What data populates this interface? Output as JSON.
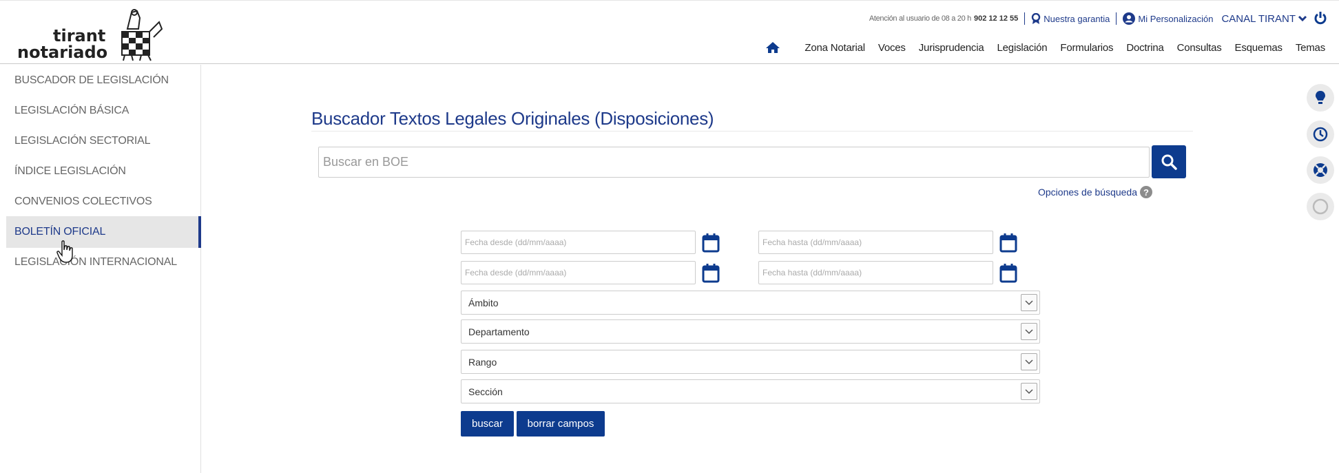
{
  "header": {
    "logo": {
      "line1": "tirant",
      "line2": "notariado"
    },
    "utility": {
      "hours": "Atención al usuario de 08 a 20 h",
      "phone": "902 12 12 55",
      "guarantee": "Nuestra garantia",
      "personalization": "Mi Personalización",
      "canal": "CANAL TIRANT"
    },
    "nav": [
      "Zona Notarial",
      "Voces",
      "Jurisprudencia",
      "Legislación",
      "Formularios",
      "Doctrina",
      "Consultas",
      "Esquemas",
      "Temas"
    ]
  },
  "sidebar": {
    "items": [
      {
        "label": "Buscador de legislación"
      },
      {
        "label": "Legislación básica"
      },
      {
        "label": "Legislación sectorial"
      },
      {
        "label": "Índice legislación"
      },
      {
        "label": "Convenios colectivos"
      },
      {
        "label": "Boletín oficial",
        "active": true
      },
      {
        "label": "Legislación internacional"
      }
    ]
  },
  "main": {
    "title": "Buscador Textos Legales Originales (Disposiciones)",
    "search_placeholder": "Buscar en BOE",
    "search_options": "Opciones de búsqueda",
    "help_glyph": "?",
    "dates": {
      "from_placeholder": "Fecha desde (dd/mm/aaaa)",
      "to_placeholder": "Fecha hasta (dd/mm/aaaa)"
    },
    "selects": [
      "Ámbito",
      "Departamento",
      "Rango",
      "Sección"
    ],
    "buttons": {
      "search": "buscar",
      "clear": "borrar campos"
    }
  },
  "colors": {
    "brand": "#0d3b8e",
    "link": "#1e3a8a",
    "sidebar_active_bg": "#e6e6e6"
  },
  "icons": [
    "home-icon",
    "search-icon",
    "calendar-icon",
    "chevron-down-icon",
    "lightbulb-icon",
    "clock-icon",
    "lifebuoy-icon",
    "circle-icon",
    "power-icon",
    "user-circle-icon",
    "award-icon",
    "hand-cursor-icon"
  ]
}
